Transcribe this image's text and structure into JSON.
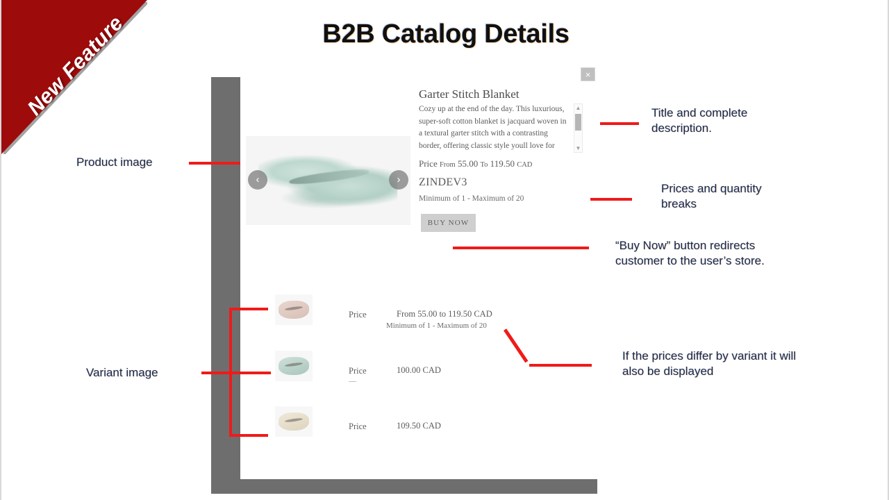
{
  "ribbon": {
    "label": "New Feature",
    "color": "#9e0b0b"
  },
  "page": {
    "title": "B2B Catalog Details",
    "accent": "#f01a1a"
  },
  "modal": {
    "close_icon": "close-icon",
    "close_glyph": "×",
    "carousel": {
      "prev_glyph": "‹",
      "next_glyph": "›"
    },
    "product": {
      "title": "Garter Stitch Blanket",
      "description": "Cozy up at the end of the day. This luxurious, super-soft cotton blanket is jacquard woven in a textural garter stitch with a contrasting border, offering classic style youll love for",
      "price_label": "Price",
      "price_from_word": "From",
      "price_from": "55.00",
      "price_to_word": "To",
      "price_to": "119.50",
      "currency": "CAD",
      "sku": "ZINDEV3",
      "min_max": "Minimum of  1  - Maximum of  20",
      "buy_button": "BUY NOW"
    },
    "scrollbar": {
      "up_glyph": "▲",
      "down_glyph": "▼"
    }
  },
  "variants": [
    {
      "swatch": "pink",
      "price_label": "Price",
      "dash": "",
      "price_text": "From  55.00  to  119.50  CAD",
      "sub_text": "Minimum of  1  - Maximum of  20"
    },
    {
      "swatch": "green",
      "price_label": "Price",
      "dash": "—",
      "price_text": "100.00  CAD",
      "sub_text": ""
    },
    {
      "swatch": "cream",
      "price_label": "Price",
      "dash": "",
      "price_text": "109.50  CAD",
      "sub_text": ""
    }
  ],
  "annotations": {
    "product_image": "Product image",
    "variant_image": "Variant image",
    "title_description": "Title and complete\ndescription.",
    "prices_quantity": "Prices and quantity\nbreaks",
    "buy_now_note": "“Buy Now” button redirects\ncustomer to the user’s store.",
    "variant_price_note": "If the prices differ by variant it will\nalso be displayed"
  }
}
